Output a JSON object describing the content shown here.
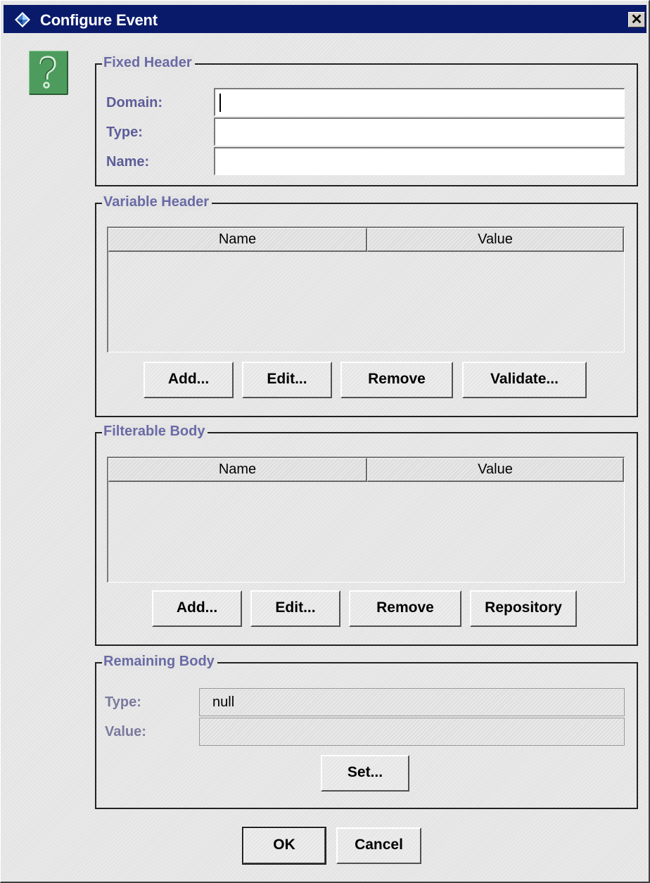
{
  "window": {
    "title": "Configure Event",
    "close_glyph": "✕"
  },
  "icons": {
    "app_icon": "diamond-app-icon",
    "help_icon": "help-question-icon"
  },
  "fixed_header": {
    "legend": "Fixed Header",
    "domain_label": "Domain:",
    "type_label": "Type:",
    "name_label": "Name:",
    "domain_value": "",
    "type_value": "",
    "name_value": ""
  },
  "variable_header": {
    "legend": "Variable Header",
    "columns": [
      "Name",
      "Value"
    ],
    "rows": [],
    "buttons": [
      "Add...",
      "Edit...",
      "Remove",
      "Validate..."
    ]
  },
  "filterable_body": {
    "legend": "Filterable Body",
    "columns": [
      "Name",
      "Value"
    ],
    "rows": [],
    "buttons": [
      "Add...",
      "Edit...",
      "Remove",
      "Repository"
    ]
  },
  "remaining_body": {
    "legend": "Remaining Body",
    "type_label": "Type:",
    "value_label": "Value:",
    "type_value": "null",
    "value_value": "",
    "set_button": "Set..."
  },
  "footer": {
    "ok_label": "OK",
    "cancel_label": "Cancel"
  },
  "colors": {
    "titlebar": "#0a1a6b",
    "label_text": "#5d5d99",
    "help_icon_bg": "#4d9c5d"
  }
}
